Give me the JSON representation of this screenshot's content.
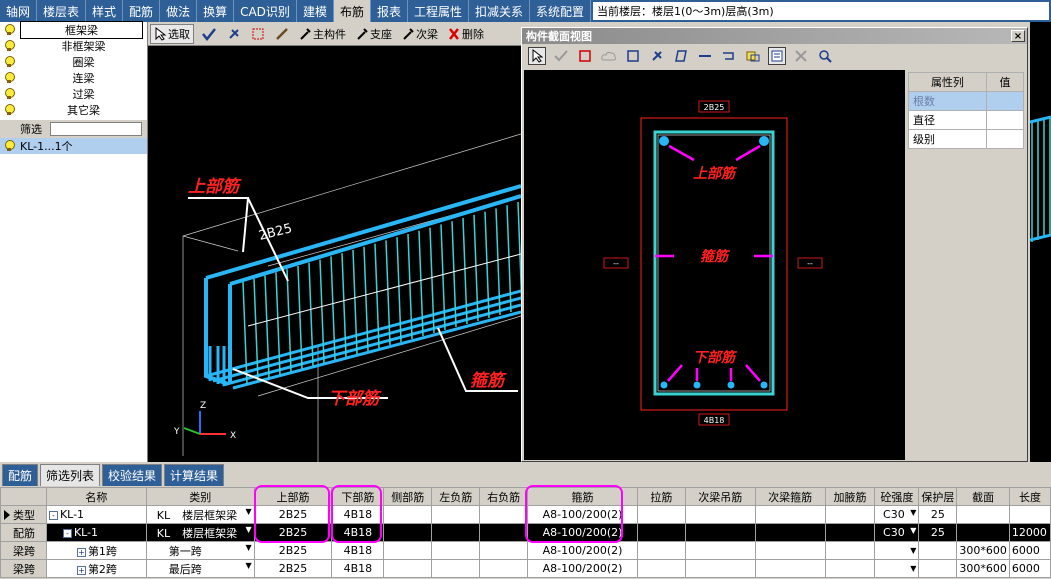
{
  "menubar": {
    "items": [
      "轴网",
      "楼层表",
      "样式",
      "配筋",
      "做法",
      "换算",
      "CAD识别",
      "建模",
      "布筋",
      "报表",
      "工程属性",
      "扣减关系",
      "系统配置"
    ],
    "active_index": 8,
    "floor_info": "当前楼层：楼层1(0～3m)层高(3m)"
  },
  "left_panel": {
    "layers": [
      "框架梁",
      "非框架梁",
      "圈梁",
      "连梁",
      "过梁",
      "其它梁"
    ],
    "filter_label": "筛选",
    "filter_value": "",
    "result": "KL-1...1个"
  },
  "viewport_toolbar": {
    "select": "选取",
    "main_member": "主构件",
    "support": "支座",
    "secondary_beam": "次梁",
    "delete": "删除"
  },
  "viewport_labels": {
    "top_bar": "上部筋",
    "top_value": "2B25",
    "stirrup": "箍筋",
    "bottom_bar": "下部筋",
    "axis_x": "X",
    "axis_y": "Y",
    "axis_z": "Z"
  },
  "section_window": {
    "title": "构件截面视图",
    "close": "×",
    "top_text": "2B25",
    "bottom_text": "4B18",
    "side_left": "--",
    "side_right": "--",
    "label_top": "上部筋",
    "label_stirrup": "箍筋",
    "label_bottom": "下部筋",
    "prop_header": [
      "属性列",
      "值"
    ],
    "props": [
      {
        "name": "根数",
        "value": ""
      },
      {
        "name": "直径",
        "value": ""
      },
      {
        "name": "级别",
        "value": ""
      }
    ]
  },
  "bottom_tabs": [
    "配筋",
    "筛选列表",
    "校验结果",
    "计算结果"
  ],
  "bottom_active_tab": 1,
  "grid": {
    "headers": [
      "",
      "名称",
      "类别",
      "上部筋",
      "下部筋",
      "侧部筋",
      "左负筋",
      "右负筋",
      "箍筋",
      "拉筋",
      "次梁吊筋",
      "次梁箍筋",
      "加腋筋",
      "砼强度",
      "保护层",
      "截面",
      "长度"
    ],
    "rows": [
      {
        "rh": "类型",
        "name": "KL-1",
        "expand": "-",
        "indent": 0,
        "cat_code": "KL",
        "cat": "楼层框架梁",
        "top": "2B25",
        "bottom": "4B18",
        "stirrup": "A8-100/200(2)",
        "concrete": "C30",
        "cover": "25",
        "section": "",
        "length": ""
      },
      {
        "rh": "配筋",
        "name": "KL-1",
        "expand": "-",
        "indent": 1,
        "cat_code": "KL",
        "cat": "楼层框架梁",
        "top": "2B25",
        "bottom": "4B18",
        "stirrup": "A8-100/200(2)",
        "concrete": "C30",
        "cover": "25",
        "section": "",
        "length": "12000"
      },
      {
        "rh": "梁跨",
        "name": "第1跨",
        "expand": "+",
        "indent": 2,
        "cat_code": "",
        "cat": "第一跨",
        "top": "2B25",
        "bottom": "4B18",
        "stirrup": "A8-100/200(2)",
        "concrete": "",
        "cover": "",
        "section": "300*600",
        "length": "6000"
      },
      {
        "rh": "梁跨",
        "name": "第2跨",
        "expand": "+",
        "indent": 2,
        "cat_code": "",
        "cat": "最后跨",
        "top": "2B25",
        "bottom": "4B18",
        "stirrup": "A8-100/200(2)",
        "concrete": "",
        "cover": "",
        "section": "300*600",
        "length": "6000"
      }
    ]
  },
  "colors": {
    "menubar": "#2f5f97",
    "rebar": "#29b6f6",
    "stirrup": "#3ad3d3",
    "annotation": "#ff2020",
    "highlight": "#ff00ff"
  }
}
